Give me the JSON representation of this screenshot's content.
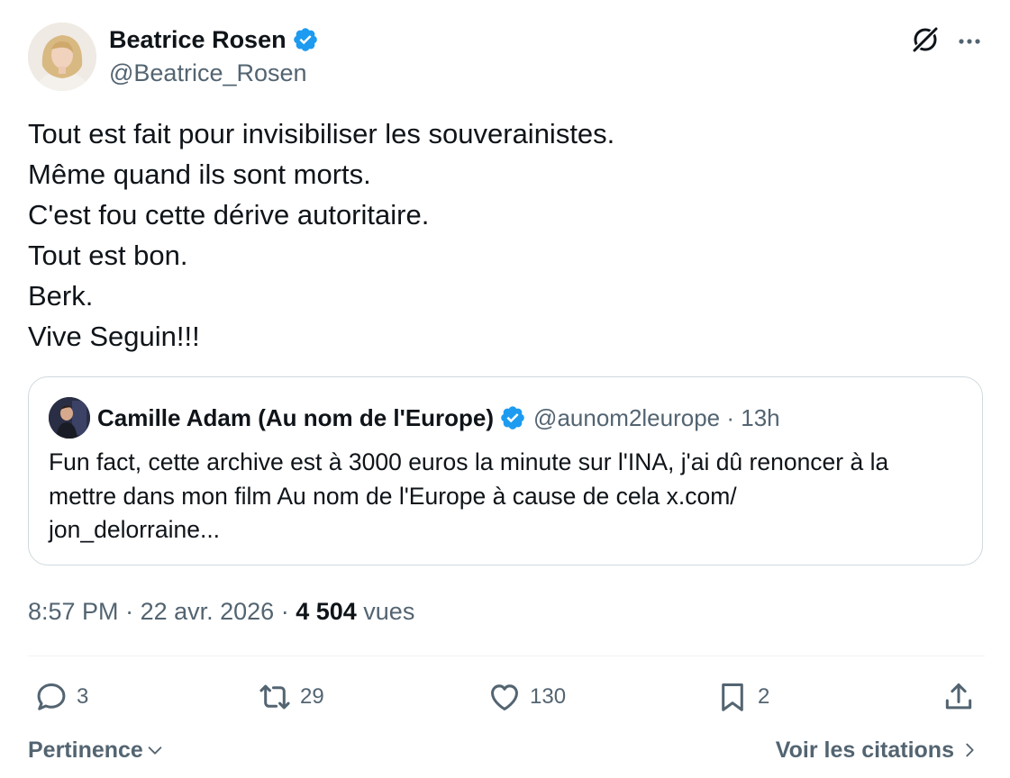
{
  "author": {
    "display_name": "Beatrice Rosen",
    "handle": "@Beatrice_Rosen",
    "verified": true
  },
  "header_icons": [
    "grok-icon",
    "more-icon"
  ],
  "tweet": {
    "lines": [
      "Tout est fait pour invisibiliser les souverainistes.",
      "Même quand ils sont morts.",
      "C'est fou cette dérive autoritaire.",
      "Tout est bon.",
      "Berk.",
      "Vive Seguin!!!"
    ]
  },
  "quote": {
    "display_name": "Camille Adam (Au nom de l'Europe)",
    "handle": "@aunom2leurope",
    "time": "13h",
    "separator": " · ",
    "lines": [
      "Fun fact, cette archive est à 3000 euros la minute sur l'INA, j'ai dû renoncer à la",
      "mettre dans mon film Au nom de l'Europe à cause de cela x.com/",
      "jon_delorraine..."
    ]
  },
  "meta": {
    "time": "8:57 PM",
    "date": "22 avr. 2026",
    "separator": " · ",
    "views_count": "4 504",
    "views_label": "vues"
  },
  "actions": {
    "replies": "3",
    "reposts": "29",
    "likes": "130",
    "bookmarks": "2"
  },
  "footer": {
    "sort_label": "Pertinence",
    "quotes_link": "Voir les citations"
  },
  "colors": {
    "text": "#0f1419",
    "secondary": "#536471",
    "verified_blue": "#1d9bf0",
    "border": "#cfd9de"
  }
}
